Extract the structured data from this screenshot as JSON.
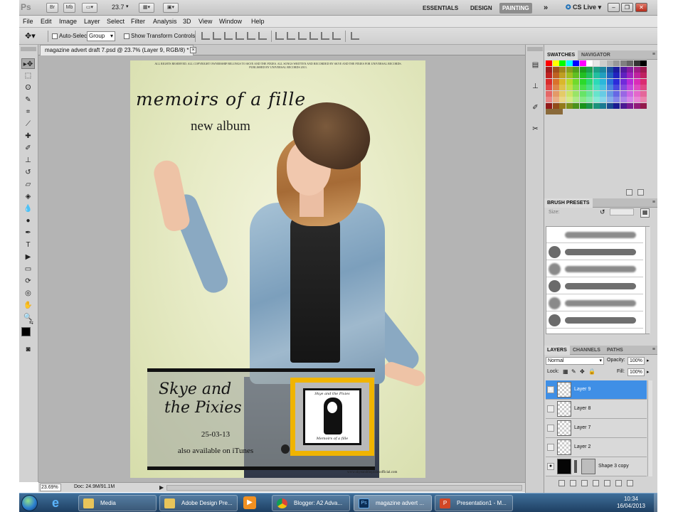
{
  "app": {
    "logo": "Ps",
    "bridge_label": "Br",
    "minibridge_label": "Mb",
    "zoom": "23.7",
    "workspaces": [
      "ESSENTIALS",
      "DESIGN",
      "PAINTING"
    ],
    "active_workspace": "PAINTING",
    "more_workspaces": "»",
    "cs_live": "CS Live"
  },
  "menu": [
    "File",
    "Edit",
    "Image",
    "Layer",
    "Select",
    "Filter",
    "Analysis",
    "3D",
    "View",
    "Window",
    "Help"
  ],
  "options": {
    "auto_select_label": "Auto-Select:",
    "auto_select_value": "Group",
    "transform_controls_label": "Show Transform Controls"
  },
  "document": {
    "tab_title": "magazine advert draft 7.psd @ 23.7% (Layer 9, RGB/8) *",
    "tab_close": "×"
  },
  "artwork": {
    "legal_text": "ALL RIGHTS RESERVED. ALL COPYRIGHT OWNERSHIP BELONGS TO SKYE AND THE PIXIES. ALL SONGS WRITTEN AND RECORDED BY SKYE AND THE PIXIES FOR UNIVERSAL RECORDS. PUBLISHED BY UNIVERSAL RECORDS 2013.",
    "album_title": "memoirs of a fille",
    "album_subtitle": "new album",
    "band_name_line1": "Skye and",
    "band_name_line2": "the Pixies",
    "release_date": "25-03-13",
    "availability": "also available on iTunes",
    "website": "www.skyeandthepixiesofficial.com",
    "cover_title": "Skye and the Pixies",
    "cover_subtitle": "Memoirs of a fille",
    "highlight_color": "#f0b400"
  },
  "status": {
    "zoom": "23.69%",
    "doc_size": "Doc: 24.9M/91.1M"
  },
  "panels": {
    "swatches_tab": "SWATCHES",
    "navigator_tab": "NAVIGATOR",
    "brush_presets_tab": "BRUSH PRESETS",
    "brush_size_label": "Size:",
    "layers_tab": "LAYERS",
    "channels_tab": "CHANNELS",
    "paths_tab": "PATHS",
    "blend_mode": "Normal",
    "opacity_label": "Opacity:",
    "opacity_value": "100%",
    "lock_label": "Lock:",
    "fill_label": "Fill:",
    "fill_value": "100%",
    "layers": [
      {
        "name": "Layer 9",
        "visible": true,
        "selected": true
      },
      {
        "name": "Layer 8",
        "visible": false,
        "selected": false
      },
      {
        "name": "Layer 7",
        "visible": false,
        "selected": false
      },
      {
        "name": "Layer 2",
        "visible": false,
        "selected": false
      },
      {
        "name": "Shape 3 copy",
        "visible": true,
        "selected": false
      }
    ]
  },
  "taskbar": {
    "items": [
      {
        "label": "Media",
        "icon": "folder-icon"
      },
      {
        "label": "Adobe Design Pre...",
        "icon": "folder-icon"
      },
      {
        "label": "Blogger: A2 Adva...",
        "icon": "chrome-icon"
      },
      {
        "label": "magazine advert ...",
        "icon": "photoshop-icon"
      },
      {
        "label": "Presentation1 - M...",
        "icon": "powerpoint-icon"
      }
    ],
    "time": "10:34",
    "date": "16/04/2013"
  }
}
